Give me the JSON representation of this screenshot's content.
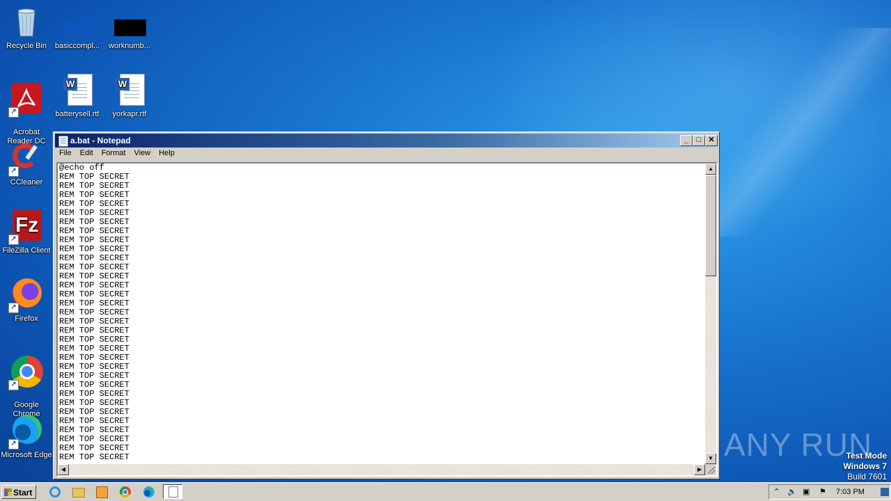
{
  "desktop": {
    "icons": [
      {
        "label": "Recycle Bin"
      },
      {
        "label": "basiccompl..."
      },
      {
        "label": "worknumb..."
      },
      {
        "label": "Acrobat\nReader DC"
      },
      {
        "label": "batterysell.rtf"
      },
      {
        "label": "yorkapr.rtf"
      },
      {
        "label": "CCleaner"
      },
      {
        "label": "FileZilla Client"
      },
      {
        "label": "Firefox"
      },
      {
        "label": "Google\nChrome"
      },
      {
        "label": "Microsoft Edge"
      }
    ]
  },
  "notepad": {
    "title": "a.bat - Notepad",
    "menu": [
      "File",
      "Edit",
      "Format",
      "View",
      "Help"
    ],
    "content_lines": [
      "@echo off",
      "REM TOP SECRET",
      "REM TOP SECRET",
      "REM TOP SECRET",
      "REM TOP SECRET",
      "REM TOP SECRET",
      "REM TOP SECRET",
      "REM TOP SECRET",
      "REM TOP SECRET",
      "REM TOP SECRET",
      "REM TOP SECRET",
      "REM TOP SECRET",
      "REM TOP SECRET",
      "REM TOP SECRET",
      "REM TOP SECRET",
      "REM TOP SECRET",
      "REM TOP SECRET",
      "REM TOP SECRET",
      "REM TOP SECRET",
      "REM TOP SECRET",
      "REM TOP SECRET",
      "REM TOP SECRET",
      "REM TOP SECRET",
      "REM TOP SECRET",
      "REM TOP SECRET",
      "REM TOP SECRET",
      "REM TOP SECRET",
      "REM TOP SECRET",
      "REM TOP SECRET",
      "REM TOP SECRET",
      "REM TOP SECRET",
      "REM TOP SECRET",
      "REM TOP SECRET"
    ]
  },
  "watermark": {
    "brand": "ANY RUN",
    "test_mode": "Test Mode",
    "os": "Windows 7",
    "build": "Build 7601"
  },
  "taskbar": {
    "start_label": "Start",
    "clock": "7:03 PM"
  }
}
